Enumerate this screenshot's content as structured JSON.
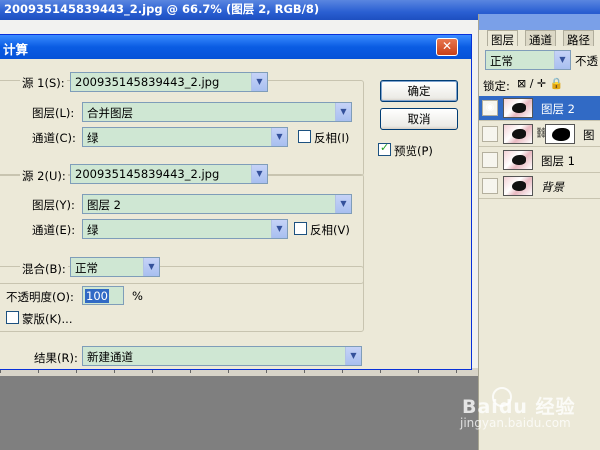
{
  "document": {
    "title": "200935145839443_2.jpg @ 66.7% (图层 2, RGB/8)"
  },
  "dialog": {
    "title": "计算",
    "close_glyph": "✕",
    "source1": {
      "label": "源 1(S):",
      "file": "200935145839443_2.jpg",
      "layer_label": "图层(L):",
      "layer_value": "合并图层",
      "channel_label": "通道(C):",
      "channel_value": "绿",
      "invert_label": "反相(I)",
      "invert_checked": false
    },
    "source2": {
      "label": "源 2(U):",
      "file": "200935145839443_2.jpg",
      "layer_label": "图层(Y):",
      "layer_value": "图层 2",
      "channel_label": "通道(E):",
      "channel_value": "绿",
      "invert_label": "反相(V)",
      "invert_checked": false
    },
    "blend": {
      "label": "混合(B):",
      "value": "正常",
      "opacity_label": "不透明度(O):",
      "opacity_value": "100",
      "opacity_unit": "%",
      "mask_label": "蒙版(K)...",
      "mask_checked": false
    },
    "result": {
      "label": "结果(R):",
      "value": "新建通道"
    },
    "ok_label": "确定",
    "cancel_label": "取消",
    "preview_label": "预览(P)",
    "preview_checked": true
  },
  "layers_panel": {
    "tabs": [
      "图层",
      "通道",
      "路径"
    ],
    "blend_mode": "正常",
    "opacity_label": "不透",
    "lock_label": "锁定:",
    "lock_icons": "⊠ ∕ ✛ 🔒",
    "layers": [
      {
        "name": "图层 2",
        "visible": true,
        "selected": true
      },
      {
        "name": "图",
        "visible": false,
        "selected": false,
        "has_mask": true
      },
      {
        "name": "图层 1",
        "visible": false,
        "selected": false
      },
      {
        "name": "背景",
        "visible": false,
        "selected": false,
        "italic": true
      }
    ]
  },
  "watermark": {
    "brand": "Baidu 经验",
    "url": "jingyan.baidu.com"
  }
}
